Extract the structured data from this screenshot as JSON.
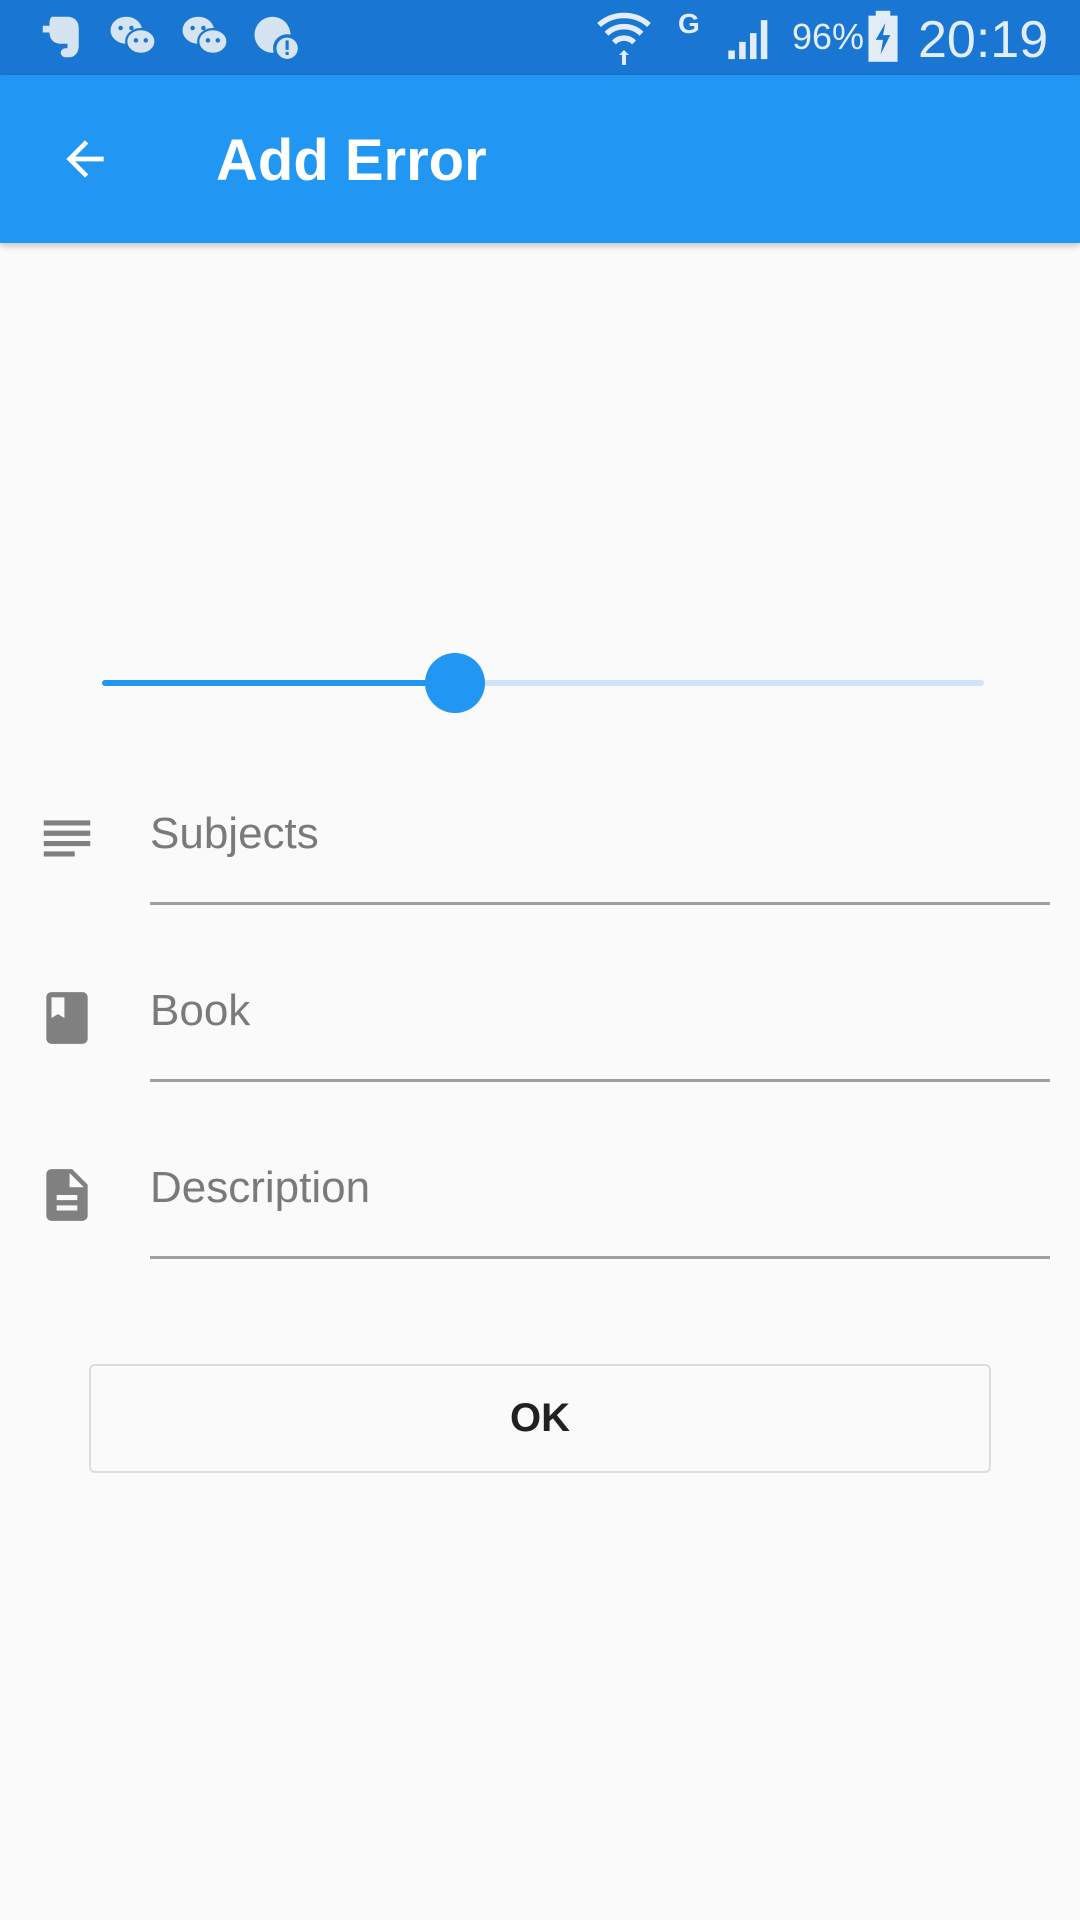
{
  "status_bar": {
    "notification_icons": [
      "evernote-icon",
      "wechat-icon",
      "wechat-icon",
      "notification-alert-icon"
    ],
    "system_icons": [
      "wifi-icon",
      "network-g-icon",
      "signal-icon",
      "battery-charging-icon"
    ],
    "network_type": "G",
    "battery_percent": "96%",
    "time": "20:19"
  },
  "app_bar": {
    "title": "Add Error",
    "back_icon": "arrow-back-icon",
    "color": "#2196f3"
  },
  "slider": {
    "value_fraction": 0.4,
    "active_color": "#2196f3",
    "inactive_color": "#cfe4f8"
  },
  "form": {
    "subjects": {
      "placeholder": "Subjects",
      "value": "",
      "icon": "subject-lines-icon"
    },
    "book": {
      "placeholder": "Book",
      "value": "",
      "icon": "book-icon"
    },
    "description": {
      "placeholder": "Description",
      "value": "",
      "icon": "description-document-icon"
    }
  },
  "ok_button": {
    "label": "OK"
  }
}
